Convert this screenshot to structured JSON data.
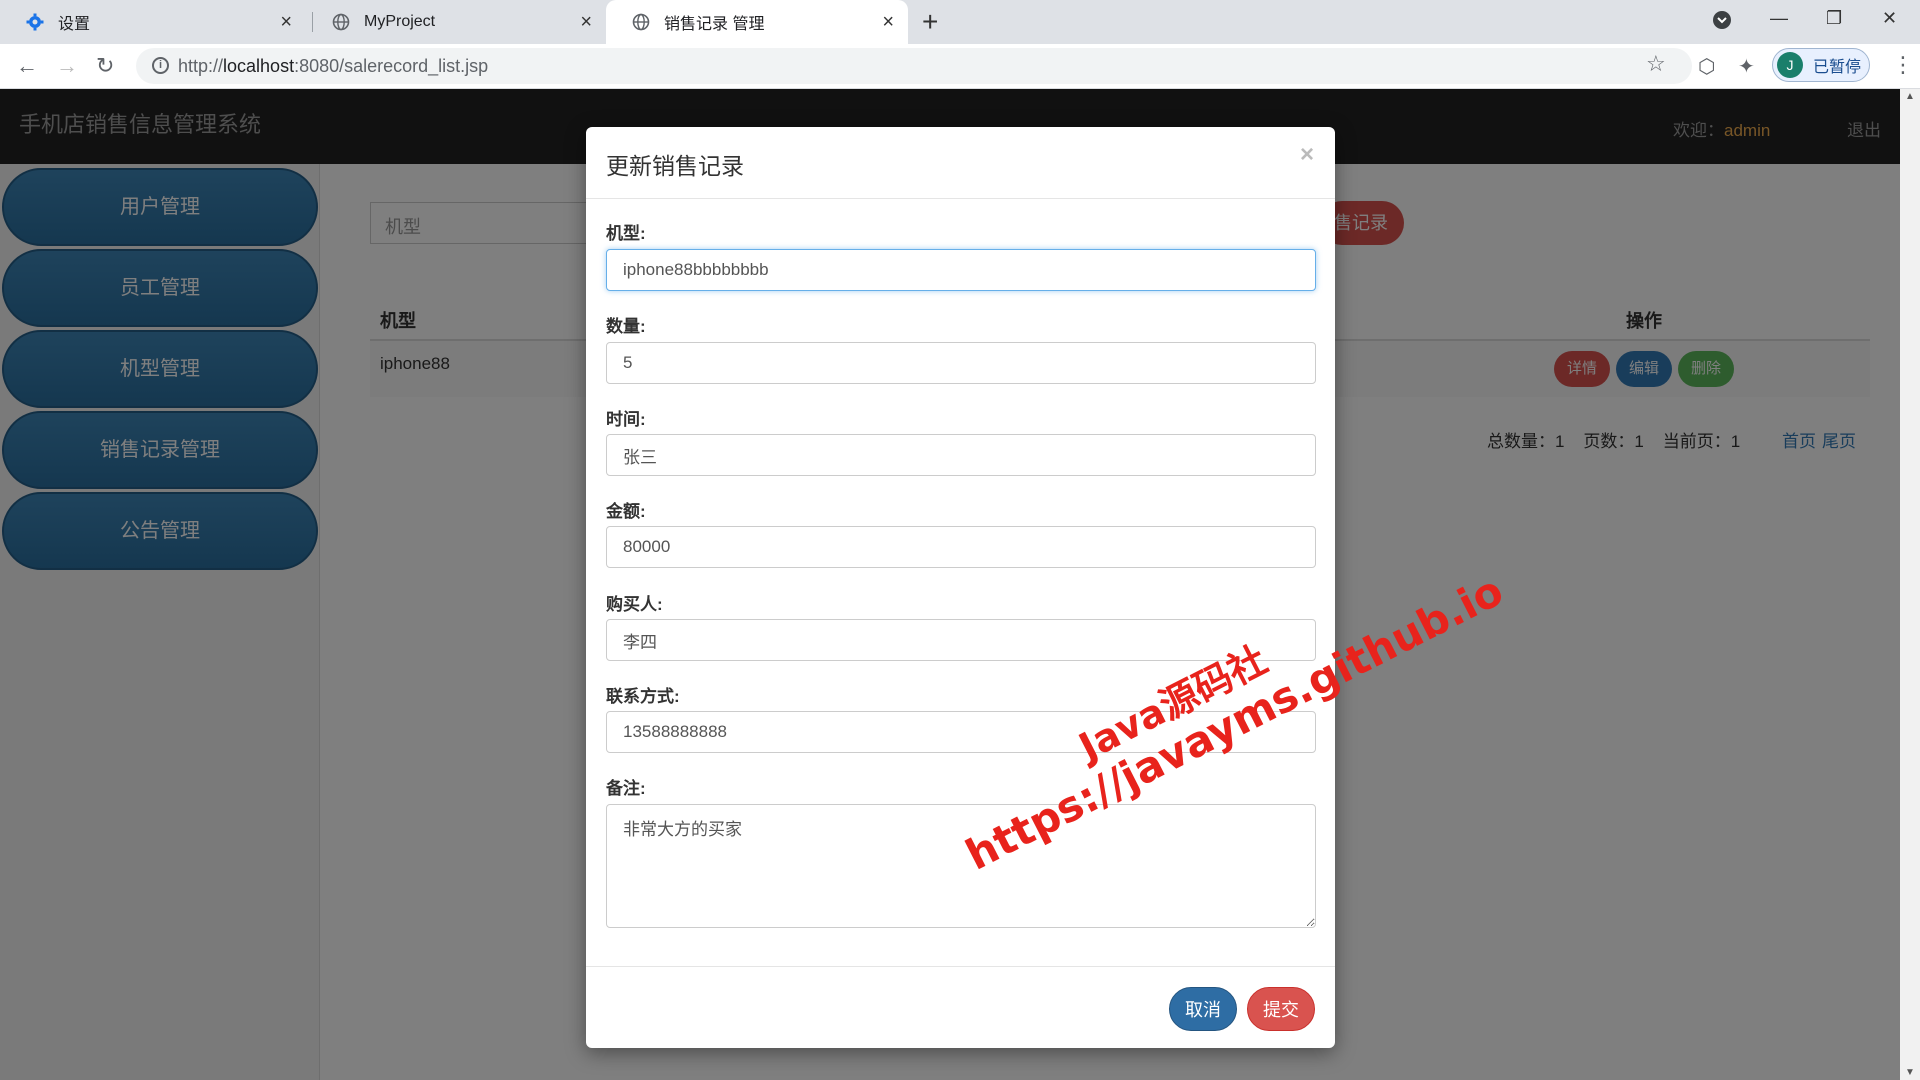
{
  "browser": {
    "tabs": [
      {
        "title": "设置",
        "icon": "gear-icon"
      },
      {
        "title": "MyProject",
        "icon": "globe-icon"
      },
      {
        "title": "销售记录 管理",
        "icon": "globe-icon"
      }
    ],
    "url_prefix": "http://",
    "url_host": "localhost",
    "url_rest": ":8080/salerecord_list.jsp",
    "profile_initial": "J",
    "profile_status": "已暂停"
  },
  "header": {
    "brand": "手机店销售信息管理系统",
    "welcome_label": "欢迎：",
    "username": "admin",
    "logout": "退出"
  },
  "sidebar": {
    "items": [
      {
        "label": "用户管理"
      },
      {
        "label": "员工管理"
      },
      {
        "label": "机型管理"
      },
      {
        "label": "销售记录管理"
      },
      {
        "label": "公告管理"
      }
    ]
  },
  "main": {
    "search_placeholder": "机型",
    "add_button": "售记录",
    "table": {
      "headers": {
        "model": "机型",
        "ops": "操作"
      },
      "rows": [
        {
          "model": "iphone88"
        }
      ],
      "ops": {
        "detail": "详情",
        "edit": "编辑",
        "delete": "删除"
      }
    },
    "pager": {
      "summary": "总数量：1    页数：1    当前页：1",
      "first": "首页",
      "last": "尾页"
    }
  },
  "modal": {
    "title": "更新销售记录",
    "close": "×",
    "fields": [
      {
        "label": "机型:",
        "value": "iphone88bbbbbbbb"
      },
      {
        "label": "数量:",
        "value": "5"
      },
      {
        "label": "时间:",
        "value": "张三"
      },
      {
        "label": "金额:",
        "value": "80000"
      },
      {
        "label": "购买人:",
        "value": "李四"
      },
      {
        "label": "联系方式:",
        "value": "13588888888"
      },
      {
        "label": "备注:",
        "value": "非常大方的买家"
      }
    ],
    "cancel": "取消",
    "submit": "提交"
  },
  "watermark": {
    "line1": "Java源码社",
    "line2": "https://javayms.github.io"
  }
}
